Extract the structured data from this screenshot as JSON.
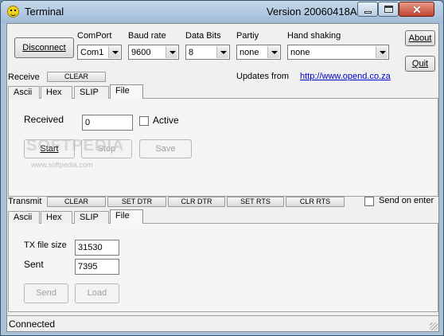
{
  "window": {
    "title": "Terminal",
    "version": "Version 20060418A"
  },
  "toolbar": {
    "disconnect_label": "Disconnect",
    "about_label": "About",
    "quit_label": "Quit",
    "comport_label": "ComPort",
    "comport_value": "Com1",
    "baud_label": "Baud rate",
    "baud_value": "9600",
    "databits_label": "Data Bits",
    "databits_value": "8",
    "parity_label": "Partiy",
    "parity_value": "none",
    "handshake_label": "Hand shaking",
    "handshake_value": "none",
    "updates_label": "Updates from",
    "updates_link": "http://www.opend.co.za"
  },
  "receive": {
    "label": "Receive",
    "clear_label": "CLEAR",
    "tabs": [
      "Ascii",
      "Hex",
      "SLIP",
      "File"
    ],
    "active_tab": "File",
    "received_label": "Received",
    "received_value": "0",
    "active_label": "Active",
    "start_label": "Start",
    "stop_label": "Stop",
    "save_label": "Save"
  },
  "transmit": {
    "label": "Transmit",
    "clear_label": "CLEAR",
    "set_dtr_label": "SET DTR",
    "clr_dtr_label": "CLR DTR",
    "set_rts_label": "SET RTS",
    "clr_rts_label": "CLR RTS",
    "send_on_enter_label": "Send on enter",
    "tabs": [
      "Ascii",
      "Hex",
      "SLIP",
      "File"
    ],
    "active_tab": "File",
    "tx_size_label": "TX file size",
    "tx_size_value": "31530",
    "sent_label": "Sent",
    "sent_value": "7395",
    "send_label": "Send",
    "load_label": "Load"
  },
  "status": {
    "text": "Connected"
  },
  "watermark": {
    "brand": "SOFTPEDIA",
    "url": "www.softpedia.com"
  }
}
